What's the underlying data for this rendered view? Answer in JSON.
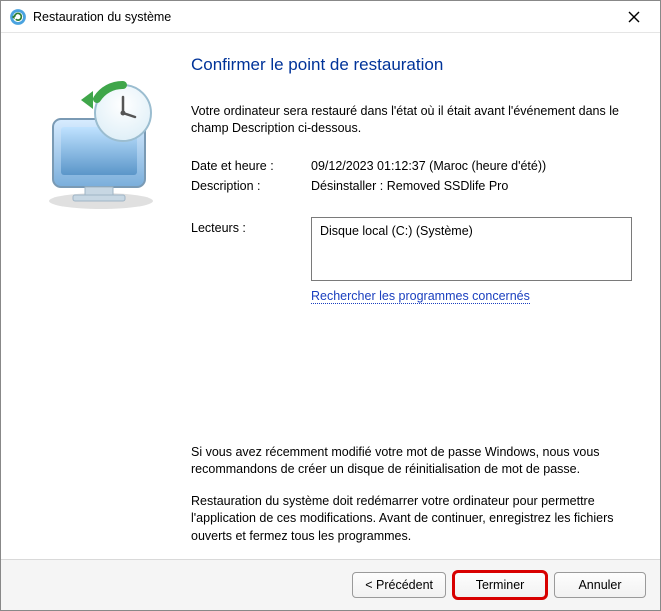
{
  "titlebar": {
    "title": "Restauration du système"
  },
  "heading": "Confirmer le point de restauration",
  "intro": "Votre ordinateur sera restauré dans l'état où il était avant l'événement dans le champ Description ci-dessous.",
  "fields": {
    "datetime_label": "Date et heure :",
    "datetime_value": "09/12/2023 01:12:37 (Maroc (heure d'été))",
    "description_label": "Description :",
    "description_value": "Désinstaller : Removed SSDlife Pro",
    "drives_label": "Lecteurs :",
    "drives_value": "Disque local (C:) (Système)"
  },
  "link": "Rechercher les programmes concernés",
  "notes": {
    "p1": "Si vous avez récemment modifié votre mot de passe Windows, nous vous recommandons de créer un disque de réinitialisation de mot de passe.",
    "p2": "Restauration du système doit redémarrer votre ordinateur pour permettre l'application de ces modifications. Avant de continuer, enregistrez les fichiers ouverts et fermez tous les programmes."
  },
  "buttons": {
    "back": "< Précédent",
    "finish": "Terminer",
    "cancel": "Annuler"
  }
}
